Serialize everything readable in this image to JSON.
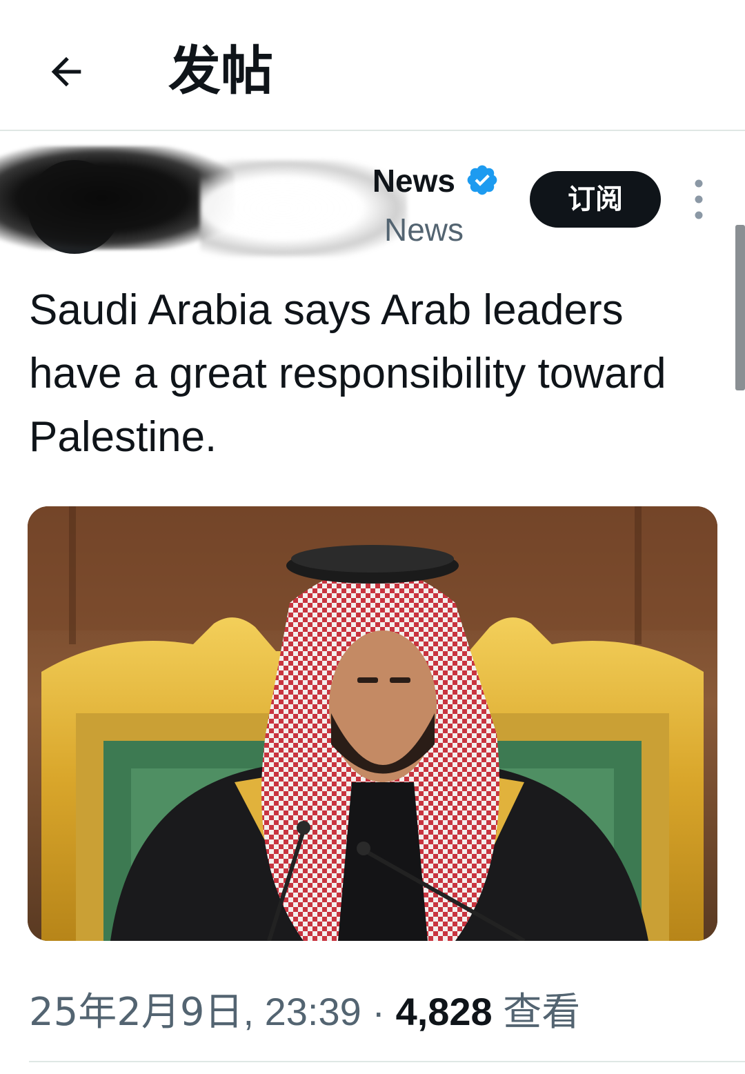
{
  "header": {
    "title": "发帖"
  },
  "author": {
    "display_name": "News",
    "handle": "News",
    "verified": true,
    "subscribe_label": "订阅"
  },
  "post": {
    "text": "Saudi Arabia says Arab leaders have a great responsibility toward Palestine."
  },
  "meta": {
    "date": "25年2月9日",
    "separator_comma": ",",
    "time": "23:39",
    "dot": "·",
    "views_count": "4,828",
    "views_label": "查看"
  },
  "colors": {
    "primary_text": "#0f1419",
    "secondary_text": "#536471",
    "verified_blue": "#1d9bf0",
    "button_bg": "#0f1419",
    "divider": "#dfe7e4"
  },
  "icons": {
    "back": "arrow-left-icon",
    "verified": "verified-badge-icon",
    "more": "more-vertical-icon"
  }
}
